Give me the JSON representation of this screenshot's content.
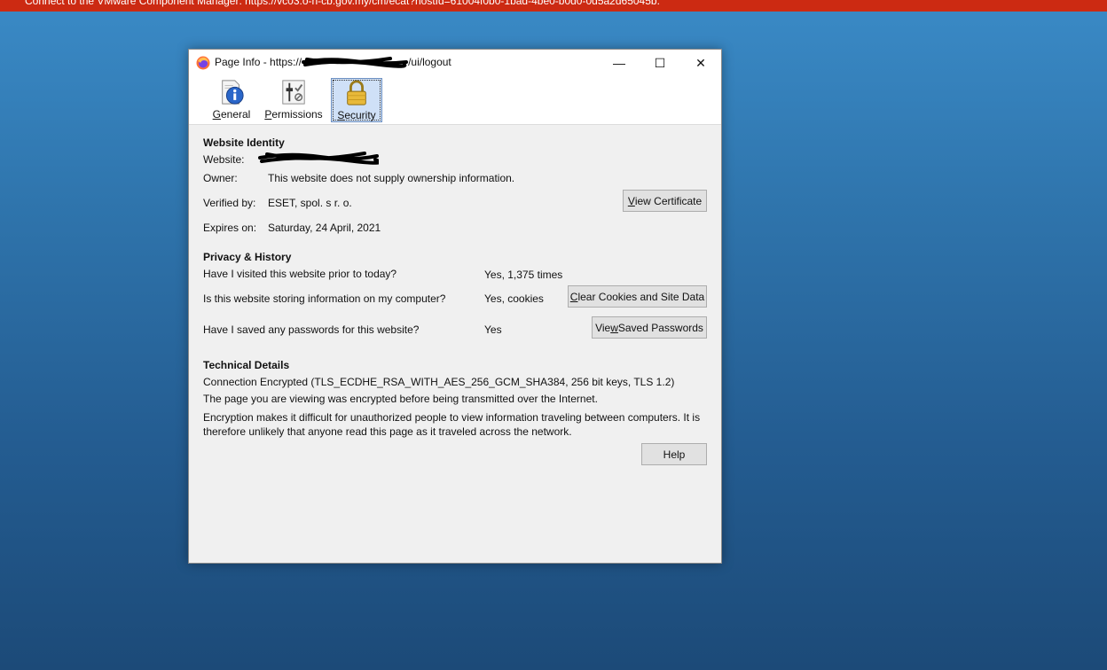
{
  "banner": {
    "text": "Connect to the VMware Component Manager: https://vc03.o-n-cb.gov.my/cm/ecat?hostId=61004f0b0-1bad-4be0-b0d0-0d5a2d65045b."
  },
  "window": {
    "title_prefix": "Page Info - https://",
    "title_suffix": "/ui/logout",
    "minimize_glyph": "—",
    "maximize_glyph": "☐",
    "close_glyph": "✕"
  },
  "tabs": [
    {
      "label": "General",
      "access_key": "G",
      "rest": "eneral",
      "icon": "info-document-icon"
    },
    {
      "label": "Permissions",
      "access_key": "P",
      "rest": "ermissions",
      "icon": "permissions-icon"
    },
    {
      "label": "Security",
      "access_key": "S",
      "rest": "ecurity",
      "icon": "padlock-icon",
      "selected": true
    }
  ],
  "identity": {
    "heading": "Website Identity",
    "website_label": "Website:",
    "owner_label": "Owner:",
    "owner_value": "This website does not supply ownership information.",
    "verified_label": "Verified by:",
    "verified_value": "ESET, spol. s r. o.",
    "expires_label": "Expires on:",
    "expires_value": "Saturday, 24 April, 2021",
    "view_cert_key": "V",
    "view_cert_rest": "iew Certificate"
  },
  "privacy": {
    "heading": "Privacy & History",
    "q_visited": "Have I visited this website prior to today?",
    "a_visited": "Yes, 1,375 times",
    "q_storing": "Is this website storing information on my computer?",
    "a_storing": "Yes, cookies",
    "clear_key": "C",
    "clear_rest": "lear Cookies and Site Data",
    "q_passwords": "Have I saved any passwords for this website?",
    "a_passwords": "Yes",
    "saved_pw_pre": "Vie",
    "saved_pw_key": "w",
    "saved_pw_rest": " Saved Passwords"
  },
  "technical": {
    "heading": "Technical Details",
    "line1": "Connection Encrypted (TLS_ECDHE_RSA_WITH_AES_256_GCM_SHA384, 256 bit keys, TLS 1.2)",
    "line2": "The page you are viewing was encrypted before being transmitted over the Internet.",
    "line3a": "Encryption makes it difficult for unauthorized people to view information traveling between computers. It is",
    "line3b": "therefore unlikely that anyone read this page as it traveled across the network.",
    "help_label": "Help"
  },
  "colors": {
    "banner": "#cc2a12",
    "desktop": "#2f75ad",
    "selected_tab": "#cfe0f7"
  }
}
